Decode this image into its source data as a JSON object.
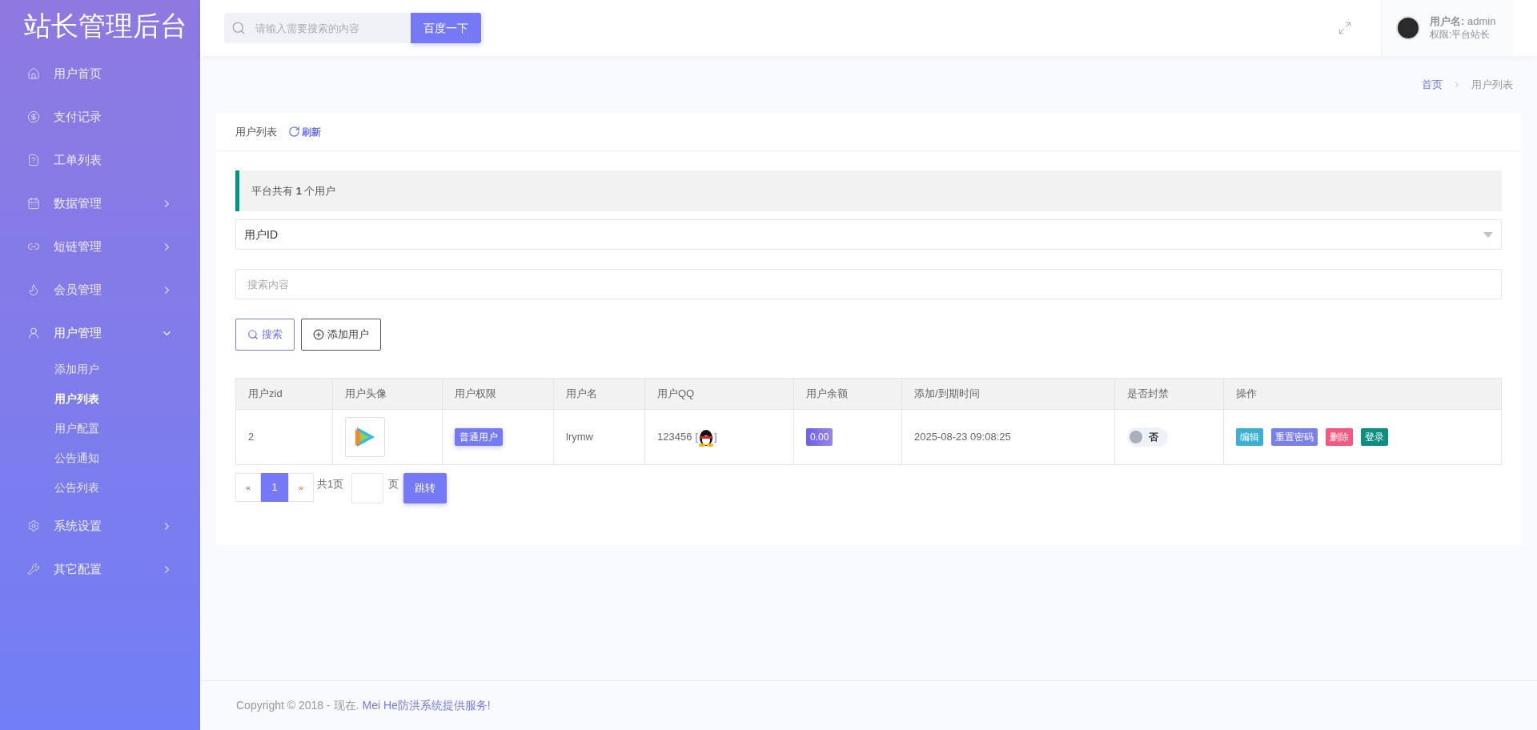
{
  "sidebar": {
    "title": "站长管理后台",
    "items": [
      {
        "kind": "link",
        "label": "用户首页"
      },
      {
        "kind": "link",
        "label": "支付记录"
      },
      {
        "kind": "link",
        "label": "工单列表"
      },
      {
        "kind": "group",
        "label": "数据管理",
        "expanded": false
      },
      {
        "kind": "group",
        "label": "短链管理",
        "expanded": false
      },
      {
        "kind": "group",
        "label": "会员管理",
        "expanded": false
      },
      {
        "kind": "group",
        "label": "用户管理",
        "expanded": true,
        "children": [
          {
            "label": "添加用户",
            "selected": false
          },
          {
            "label": "用户列表",
            "selected": true
          },
          {
            "label": "用户配置",
            "selected": false
          },
          {
            "label": "公告通知",
            "selected": false
          },
          {
            "label": "公告列表",
            "selected": false
          }
        ]
      },
      {
        "kind": "group",
        "label": "系统设置",
        "expanded": false
      },
      {
        "kind": "group",
        "label": "其它配置",
        "expanded": false
      }
    ]
  },
  "header": {
    "search": {
      "placeholder": "请输入需要搜索的内容",
      "button": "百度一下"
    },
    "user": {
      "name_label": "用户名:",
      "name": "admin",
      "role_label": "权限:",
      "role": "平台站长"
    }
  },
  "breadcrumb": [
    {
      "label": "首页",
      "current": false
    },
    {
      "label": "用户列表",
      "current": true
    }
  ],
  "card": {
    "title": "用户列表",
    "refresh": "刷新",
    "notice": "平台共有 **1** 个用户",
    "filter": {
      "value": "用户ID"
    },
    "search": {
      "placeholder": "搜索内容"
    },
    "buttons": [
      {
        "kind": "search",
        "label": "搜索"
      },
      {
        "kind": "add",
        "label": "添加用户"
      }
    ],
    "table": {
      "columns": [
        "用户zid",
        "用户头像",
        "用户权限",
        "用户名",
        "用户QQ",
        "用户余额",
        "添加/到期时间",
        "是否封禁",
        "操作"
      ],
      "rows": [
        {
          "zid": "2",
          "role": "普通用户",
          "username": "lrymw",
          "qq": "123456",
          "qq_open": "[",
          "qq_close": "]",
          "balance": "0.00",
          "time": "2025-08-23 09:08:25",
          "banned": false,
          "banned_label": "否",
          "actions": [
            {
              "label": "编辑",
              "color": "#3ab0d4"
            },
            {
              "label": "重置密码",
              "color": "#7a7ff0"
            },
            {
              "label": "删除",
              "color": "#f7577f"
            },
            {
              "label": "登录",
              "color": "#0c8f7f"
            }
          ]
        }
      ]
    },
    "pagination": {
      "prev": "«",
      "pages": [
        {
          "label": "1",
          "selected": true
        }
      ],
      "next": "»",
      "total": "共1页",
      "page_unit": "页",
      "go": "跳转"
    }
  },
  "footer": {
    "text": "Copyright © 2018 - 现在.",
    "link": "Mei He防洪系统提供服务!"
  }
}
